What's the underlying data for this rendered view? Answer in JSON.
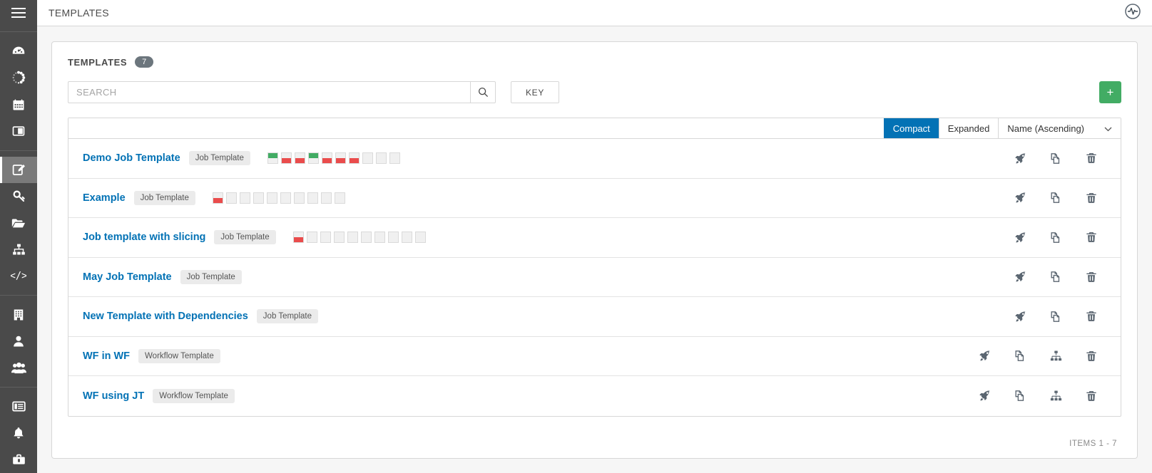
{
  "sidebar": {
    "toggle": {
      "name": "menu-toggle",
      "icon": "hamburger-icon"
    },
    "groups": [
      {
        "items": [
          {
            "icon": "dashboard-icon",
            "label": "Dashboard",
            "active": false
          },
          {
            "icon": "jobs-icon",
            "label": "Jobs",
            "active": false
          },
          {
            "icon": "schedules-icon",
            "label": "Schedules",
            "active": false
          },
          {
            "icon": "portal-icon",
            "label": "My View",
            "active": false
          }
        ]
      },
      {
        "items": [
          {
            "icon": "templates-icon",
            "label": "Templates",
            "active": true
          },
          {
            "icon": "credentials-icon",
            "label": "Credentials",
            "active": false
          },
          {
            "icon": "projects-icon",
            "label": "Projects",
            "active": false
          },
          {
            "icon": "inventories-icon",
            "label": "Inventories",
            "active": false
          },
          {
            "icon": "inventory-scripts-icon",
            "label": "Inventory Scripts",
            "active": false
          }
        ]
      },
      {
        "items": [
          {
            "icon": "organizations-icon",
            "label": "Organizations",
            "active": false
          },
          {
            "icon": "users-icon",
            "label": "Users",
            "active": false
          },
          {
            "icon": "teams-icon",
            "label": "Teams",
            "active": false
          }
        ]
      },
      {
        "items": [
          {
            "icon": "credential-types-icon",
            "label": "Credential Types",
            "active": false
          },
          {
            "icon": "notifications-icon",
            "label": "Notifications",
            "active": false
          },
          {
            "icon": "management-jobs-icon",
            "label": "Management Jobs",
            "active": false
          }
        ]
      }
    ]
  },
  "topbar": {
    "breadcrumb": "TEMPLATES",
    "logo": "brand-logo-icon"
  },
  "panel": {
    "title": "TEMPLATES",
    "count": "7"
  },
  "toolbar": {
    "search_value": "",
    "search_placeholder": "SEARCH",
    "search_icon": "search-icon",
    "key_label": "KEY",
    "add_label": "+"
  },
  "list_header": {
    "compact_label": "Compact",
    "expanded_label": "Expanded",
    "sort_label": "Name (Ascending)",
    "sort_caret": "chevron-down-icon",
    "selected_mode": "Compact"
  },
  "colors": {
    "accent_blue": "#0372b5",
    "green": "#42ac64",
    "red": "#ea4c4c",
    "badge_gray": "#6c767d",
    "sidebar": "#4a4a4a"
  },
  "rows": [
    {
      "name": "Demo Job Template",
      "type": "Job Template",
      "sparkline": [
        "success",
        "failed",
        "failed",
        "success",
        "failed",
        "failed",
        "failed",
        "empty",
        "empty",
        "empty"
      ],
      "actions": [
        "launch-icon",
        "copy-icon",
        "delete-icon"
      ]
    },
    {
      "name": "Example",
      "type": "Job Template",
      "sparkline": [
        "failed",
        "empty",
        "empty",
        "empty",
        "empty",
        "empty",
        "empty",
        "empty",
        "empty",
        "empty"
      ],
      "actions": [
        "launch-icon",
        "copy-icon",
        "delete-icon"
      ]
    },
    {
      "name": "Job template with slicing",
      "type": "Job Template",
      "sparkline": [
        "failed",
        "empty",
        "empty",
        "empty",
        "empty",
        "empty",
        "empty",
        "empty",
        "empty",
        "empty"
      ],
      "actions": [
        "launch-icon",
        "copy-icon",
        "delete-icon"
      ]
    },
    {
      "name": "May Job Template",
      "type": "Job Template",
      "sparkline": [],
      "actions": [
        "launch-icon",
        "copy-icon",
        "delete-icon"
      ]
    },
    {
      "name": "New Template with Dependencies",
      "type": "Job Template",
      "sparkline": [],
      "actions": [
        "launch-icon",
        "copy-icon",
        "delete-icon"
      ]
    },
    {
      "name": "WF in WF",
      "type": "Workflow Template",
      "sparkline": [],
      "actions": [
        "launch-icon",
        "copy-icon",
        "workflow-visualizer-icon",
        "delete-icon"
      ]
    },
    {
      "name": "WF using JT",
      "type": "Workflow Template",
      "sparkline": [],
      "actions": [
        "launch-icon",
        "copy-icon",
        "workflow-visualizer-icon",
        "delete-icon"
      ]
    }
  ],
  "footer": {
    "items_label": "ITEMS  1 - 7"
  }
}
